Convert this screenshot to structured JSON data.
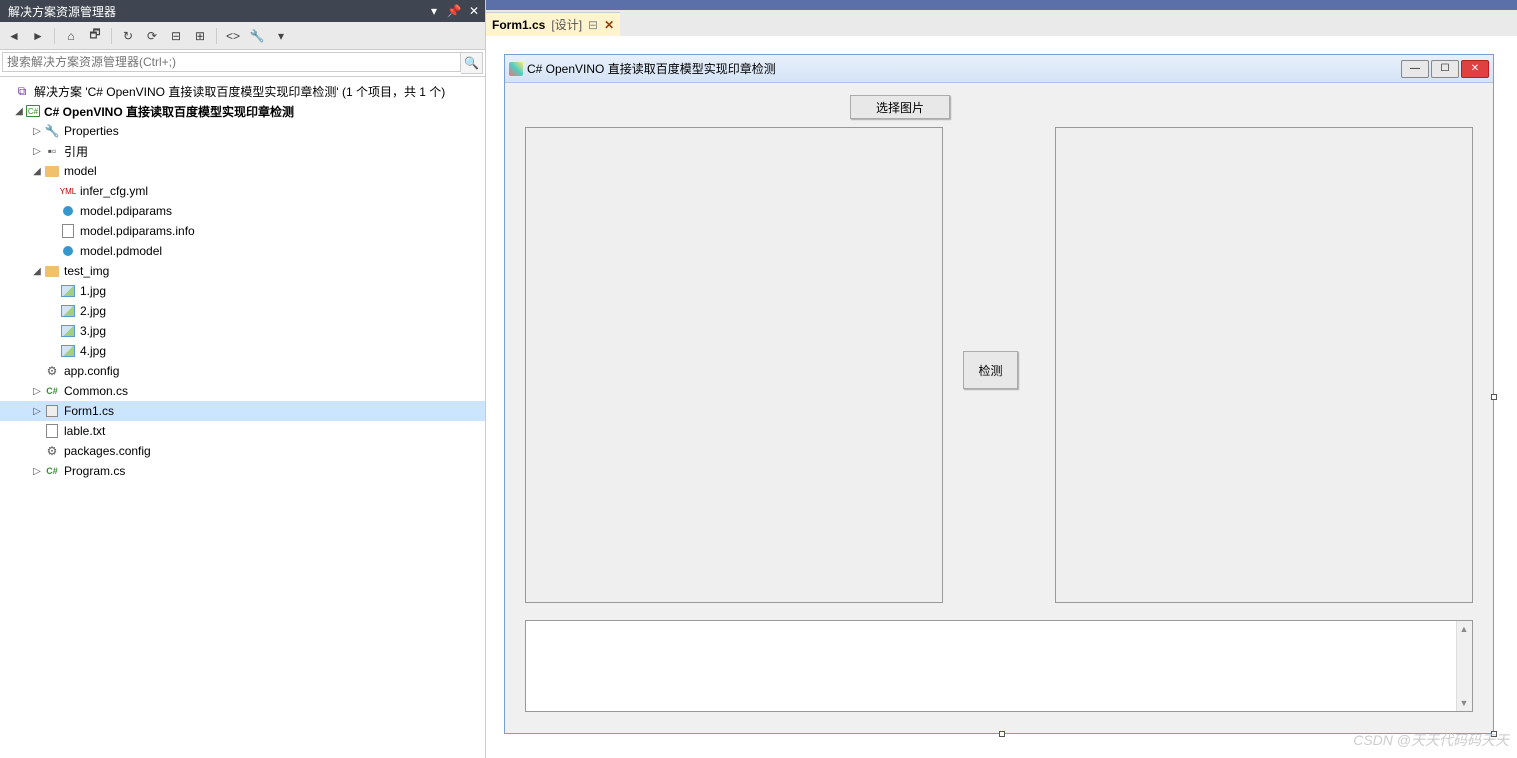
{
  "solutionExplorer": {
    "title": "解决方案资源管理器",
    "searchPlaceholder": "搜索解决方案资源管理器(Ctrl+;)",
    "solutionLabel": "解决方案 'C# OpenVINO 直接读取百度模型实现印章检测' (1 个项目，共 1 个)",
    "projectLabel": "C# OpenVINO 直接读取百度模型实现印章检测",
    "nodes": {
      "properties": "Properties",
      "references": "引用",
      "model": "model",
      "infer_cfg": "infer_cfg.yml",
      "pdiparams": "model.pdiparams",
      "pdiparams_info": "model.pdiparams.info",
      "pdmodel": "model.pdmodel",
      "test_img": "test_img",
      "img1": "1.jpg",
      "img2": "2.jpg",
      "img3": "3.jpg",
      "img4": "4.jpg",
      "app_config": "app.config",
      "common": "Common.cs",
      "form1": "Form1.cs",
      "lable": "lable.txt",
      "packages": "packages.config",
      "program": "Program.cs"
    }
  },
  "tab": {
    "label": "Form1.cs",
    "suffix": "[设计]"
  },
  "form": {
    "title": "C# OpenVINO 直接读取百度模型实现印章检测",
    "btnSelect": "选择图片",
    "btnDetect": "检测"
  },
  "watermark": "CSDN @天天代码码天天"
}
